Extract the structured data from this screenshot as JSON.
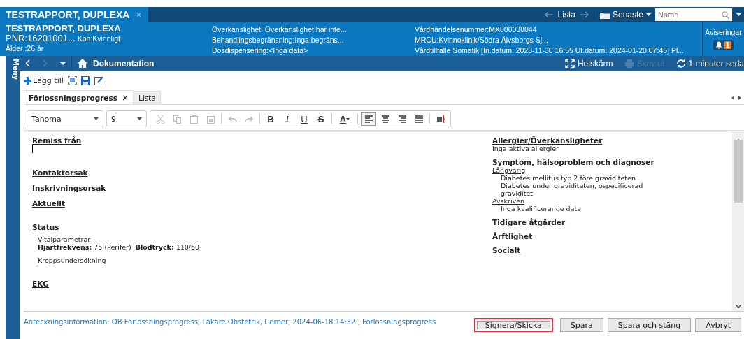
{
  "patient_tab": {
    "title": "TESTRAPPORT, DUPLEXA",
    "close": "×"
  },
  "top_nav": {
    "list_label": "Lista",
    "recent_label": "Senaste",
    "search": {
      "placeholder": "Namn"
    }
  },
  "banner": {
    "name": "TESTRAPPORT, DUPLEXA",
    "pnr": "PNR:16201001...",
    "gender": "Kön:Kvinnligt",
    "age": "Ålder :26 år",
    "column_2": [
      "Överkänslighet: Överkänslighet har inte...",
      "Behandlingsbegränsning:Inga begräns...",
      "Dosdispensering:<Inga data>"
    ],
    "column_3": [
      "Vårdhändelsenummer:MX000038044",
      "MRCU:Kvinnoklinik/Södra Älvsborgs Sj...",
      "Vårdtillfälle Somatik [In.datum: 2023-11-30 16:55 Ut.datum: 2024-01-20 07:45] Pl..."
    ],
    "notifications": {
      "label": "Aviseringar",
      "count": "1"
    }
  },
  "nav_bar": {
    "title": "Dokumentation",
    "actions": [
      {
        "kind": "fullscreen",
        "label": "Helskärm",
        "disabled": false
      },
      {
        "kind": "print",
        "label": "Skriv ut",
        "disabled": true
      },
      {
        "kind": "refresh",
        "label": "1 minuter seda",
        "disabled": false
      }
    ]
  },
  "side_menu": {
    "label": "Meny"
  },
  "toolbar": {
    "add_label": "Lägg till"
  },
  "doc_tabs": [
    {
      "label": "Förlossningsprogress",
      "selected": true,
      "close": "×"
    },
    {
      "label": "Lista",
      "selected": false
    }
  ],
  "format_toolbar": {
    "font": "Tahoma",
    "size": "9",
    "buttons": [
      {
        "kind": "cut",
        "disabled": true
      },
      {
        "kind": "copy",
        "disabled": true
      },
      {
        "kind": "paste",
        "disabled": true
      },
      {
        "kind": "paste2",
        "disabled": true
      },
      {
        "kind": "sep"
      },
      {
        "kind": "undo",
        "disabled": true
      },
      {
        "kind": "redo",
        "disabled": true
      },
      {
        "kind": "sep"
      },
      {
        "kind": "bold",
        "label": "B"
      },
      {
        "kind": "italic",
        "label": "I"
      },
      {
        "kind": "underline",
        "label": "U"
      },
      {
        "kind": "strike",
        "label": "S"
      },
      {
        "kind": "sep"
      },
      {
        "kind": "color",
        "label": "A"
      },
      {
        "kind": "sep"
      },
      {
        "kind": "align-left",
        "selected": true
      },
      {
        "kind": "align-center",
        "selected": false
      },
      {
        "kind": "align-right",
        "selected": false
      },
      {
        "kind": "justify",
        "selected": false
      },
      {
        "kind": "sep"
      },
      {
        "kind": "field"
      }
    ]
  },
  "left_sections": [
    {
      "heading": "Remiss från",
      "cursor": true
    },
    {
      "heading": "Kontaktorsak"
    },
    {
      "heading": "Inskrivningsorsak"
    },
    {
      "heading": "Aktuellt"
    },
    {
      "heading": "Status",
      "subsections": [
        {
          "link": "Vitalparametrar",
          "values": [
            {
              "label": "Hjärtfrekvens:",
              "value": "75 (Perifer)"
            },
            {
              "label": "Blodtryck:",
              "value": "110/60"
            }
          ]
        },
        {
          "link": "Kroppsundersökning"
        }
      ]
    },
    {
      "heading": "EKG"
    }
  ],
  "right_sections": [
    {
      "heading": "Allergier/Överkänsligheter",
      "lines": [
        "Inga aktiva allergier"
      ]
    },
    {
      "heading": "Symptom, hälsoproblem och diagnoser",
      "groups": [
        {
          "label": "Långvarig",
          "items": [
            "Diabetes mellitus typ 2 före graviditeten",
            "Diabetes under graviditeten, ospecificerad graviditet"
          ]
        },
        {
          "label": "Avskriven",
          "items": [
            "Inga kvalificerande data"
          ]
        }
      ]
    },
    {
      "heading": "Tidigare åtgärder"
    },
    {
      "heading": "Ärftlighet"
    },
    {
      "heading": "Socialt"
    }
  ],
  "footer": {
    "info": "Anteckningsinformation: OB Förlossningsprogress, Läkare Obstetrik, Cerner, 2024-06-18 14:32 , Förlossningsprogress",
    "buttons": [
      {
        "label": "Signera/Skicka",
        "highlighted": true
      },
      {
        "label": "Spara",
        "highlighted": false
      },
      {
        "label": "Spara och stäng",
        "highlighted": false
      },
      {
        "label": "Avbryt",
        "highlighted": false
      }
    ]
  }
}
